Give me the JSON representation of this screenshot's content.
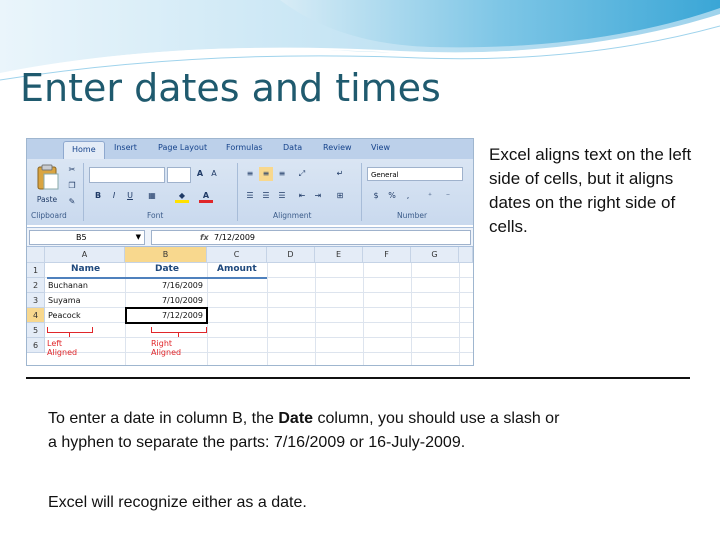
{
  "slide": {
    "title": "Enter dates and times",
    "side_text": "Excel aligns text on the left side of cells, but it aligns dates on the right side of cells.",
    "body_part1": "To enter a date in column B, the ",
    "body_bold": "Date",
    "body_part2": " column, you should use a slash or a hyphen to separate the parts: 7/16/2009 or 16-July-2009.",
    "body2": "Excel will recognize either as a date."
  },
  "excel": {
    "tabs": [
      "Home",
      "Insert",
      "Page Layout",
      "Formulas",
      "Data",
      "Review",
      "View"
    ],
    "groups": [
      "Clipboard",
      "Font",
      "Alignment",
      "Number"
    ],
    "paste_label": "Paste",
    "name_box": "B5",
    "fx_symbol": "fx",
    "formula_value": "7/12/2009",
    "columns": [
      "A",
      "B",
      "C",
      "D",
      "E",
      "F",
      "G"
    ],
    "rows": [
      "1",
      "2",
      "3",
      "4",
      "5",
      "6"
    ],
    "headers": [
      "Name",
      "Date",
      "Amount"
    ],
    "names": [
      "Buchanan",
      "Suyama",
      "Peacock"
    ],
    "dates": [
      "7/16/2009",
      "7/10/2009",
      "7/12/2009"
    ],
    "left_note": "Left Aligned",
    "right_note": "Right Aligned",
    "number_format": "General",
    "font_buttons": [
      "B",
      "I",
      "U"
    ],
    "number_symbols": [
      "$",
      "%",
      ","
    ]
  },
  "colors": {
    "title": "#1f5a6e",
    "annotation": "#e0262a",
    "selected_header": "#f8d88e",
    "ribbon": "#c9d9ee"
  }
}
